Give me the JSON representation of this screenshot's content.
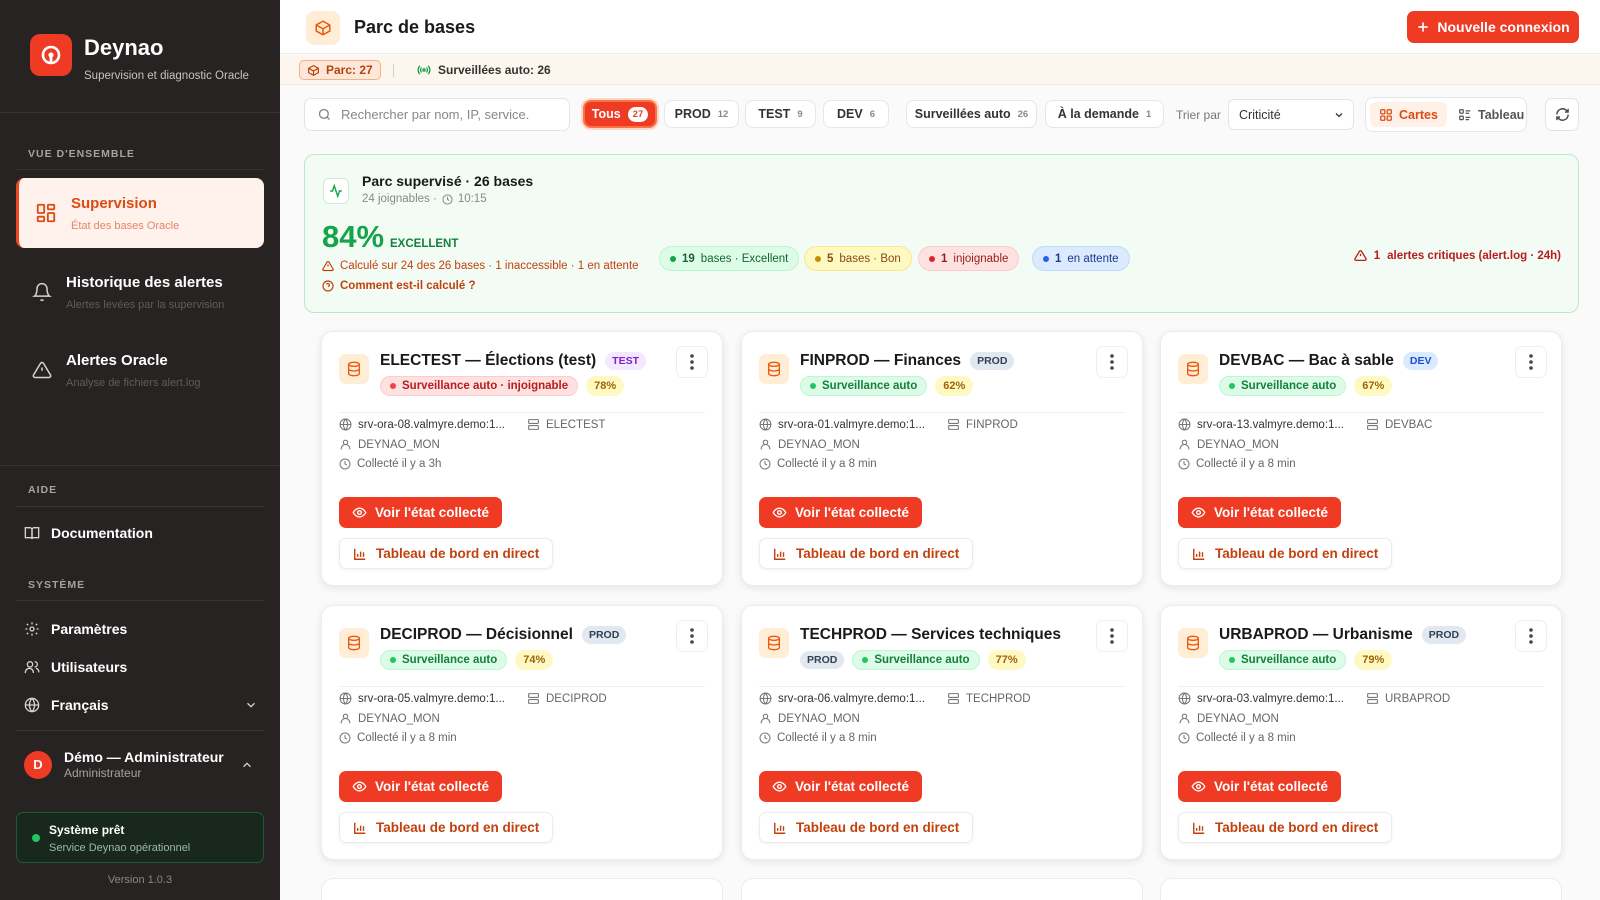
{
  "colors": {
    "accent": "#ef3b24",
    "sidebar": "#262322",
    "success": "#16a34a",
    "warning": "#c2410c",
    "danger": "#b91c1c"
  },
  "brand": {
    "name": "Deynao",
    "tagline": "Supervision et diagnostic Oracle",
    "icon": "deynao-logo"
  },
  "sidebar": {
    "section_overview": "VUE D'ENSEMBLE",
    "nav": [
      {
        "label": "Supervision",
        "sub": "État des bases Oracle",
        "icon": "dashboard-icon",
        "active": true
      },
      {
        "label": "Historique des alertes",
        "sub": "Alertes levées par la supervision",
        "icon": "bell-icon"
      },
      {
        "label": "Alertes Oracle",
        "sub": "Analyse de fichiers alert.log",
        "icon": "warning-icon"
      }
    ],
    "section_help": "AIDE",
    "documentation": "Documentation",
    "section_system": "SYSTÈME",
    "settings": "Paramètres",
    "users": "Utilisateurs",
    "language": "Français",
    "user": {
      "initial": "D",
      "name": "Démo — Administrateur",
      "role": "Administrateur"
    },
    "status": {
      "title": "Système prêt",
      "sub": "Service Deynao opérationnel"
    },
    "version": "Version 1.0.3"
  },
  "header": {
    "title": "Parc de bases",
    "new_button": "Nouvelle connexion"
  },
  "subbar": {
    "parc": "Parc: 27",
    "surveillees": "Surveillées auto: 26"
  },
  "toolbar": {
    "search_placeholder": "Rechercher par nom, IP, service.",
    "filters": [
      {
        "label": "Tous",
        "count": "27",
        "active": true
      },
      {
        "label": "PROD",
        "count": "12"
      },
      {
        "label": "TEST",
        "count": "9"
      },
      {
        "label": "DEV",
        "count": "6"
      },
      {
        "label": "Surveillées auto",
        "count": "26"
      },
      {
        "label": "À la demande",
        "count": "1"
      }
    ],
    "sort_label": "Trier par",
    "sort_value": "Criticité",
    "view_cards": "Cartes",
    "view_table": "Tableau"
  },
  "banner": {
    "title": "Parc supervisé · 26 bases",
    "sub_reachable": "24 joignables ·",
    "sub_time": "10:15",
    "percent": "84%",
    "level": "EXCELLENT",
    "calc": "Calculé sur 24 des 26 bases · 1 inaccessible · 1 en attente",
    "how": "Comment est-il calculé ?",
    "pills": [
      {
        "count": "19",
        "text": "bases · Excellent",
        "kind": "green"
      },
      {
        "count": "5",
        "text": "bases · Bon",
        "kind": "yellow"
      },
      {
        "count": "1",
        "text": "injoignable",
        "kind": "red"
      },
      {
        "count": "1",
        "text": "en attente",
        "kind": "blue"
      }
    ],
    "critical_count": "1",
    "critical_text": "alertes critiques (alert.log · 24h)"
  },
  "card_actions": {
    "view": "Voir l'état collecté",
    "dashboard": "Tableau de bord en direct"
  },
  "cards": [
    {
      "title": "ELECTEST — Élections (test)",
      "env": "TEST",
      "monitor": "Surveillance auto · injoignable",
      "monitor_ok": false,
      "score": "78%",
      "host": "srv-ora-08.valmyre.demo:1...",
      "service": "ELECTEST",
      "user": "DEYNAO_MON",
      "collected": "Collecté il y a 3h"
    },
    {
      "title": "FINPROD — Finances",
      "env": "PROD",
      "monitor": "Surveillance auto",
      "monitor_ok": true,
      "score": "62%",
      "host": "srv-ora-01.valmyre.demo:1...",
      "service": "FINPROD",
      "user": "DEYNAO_MON",
      "collected": "Collecté il y a 8 min"
    },
    {
      "title": "DEVBAC — Bac à sable",
      "env": "DEV",
      "monitor": "Surveillance auto",
      "monitor_ok": true,
      "score": "67%",
      "host": "srv-ora-13.valmyre.demo:1...",
      "service": "DEVBAC",
      "user": "DEYNAO_MON",
      "collected": "Collecté il y a 8 min"
    },
    {
      "title": "DECIPROD — Décisionnel",
      "env": "PROD",
      "monitor": "Surveillance auto",
      "monitor_ok": true,
      "score": "74%",
      "host": "srv-ora-05.valmyre.demo:1...",
      "service": "DECIPROD",
      "user": "DEYNAO_MON",
      "collected": "Collecté il y a 8 min"
    },
    {
      "title": "TECHPROD — Services techniques",
      "env": "PROD",
      "monitor": "Surveillance auto",
      "monitor_ok": true,
      "score": "77%",
      "host": "srv-ora-06.valmyre.demo:1...",
      "service": "TECHPROD",
      "user": "DEYNAO_MON",
      "collected": "Collecté il y a 8 min"
    },
    {
      "title": "URBAPROD — Urbanisme",
      "env": "PROD",
      "monitor": "Surveillance auto",
      "monitor_ok": true,
      "score": "79%",
      "host": "srv-ora-03.valmyre.demo:1...",
      "service": "URBAPROD",
      "user": "DEYNAO_MON",
      "collected": "Collecté il y a 8 min"
    }
  ]
}
